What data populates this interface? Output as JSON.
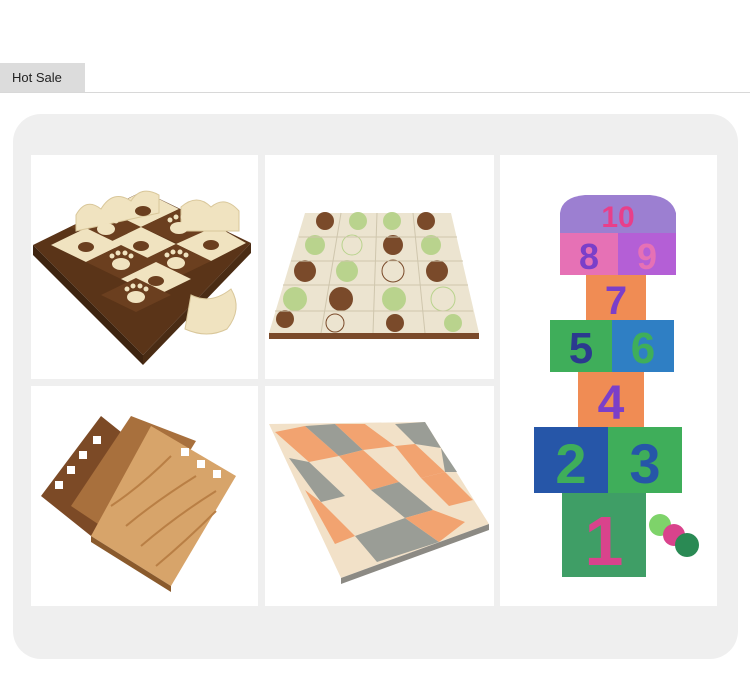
{
  "section": {
    "tab_label": "Hot Sale"
  },
  "products": [
    {
      "name": "paw-print-foam-mat-with-fence",
      "colors": [
        "#6b3f1f",
        "#f0e3c0"
      ]
    },
    {
      "name": "green-brown-circle-foam-mat",
      "colors": [
        "#7a4a2a",
        "#b9d38d",
        "#ece4d0"
      ]
    },
    {
      "name": "hopscotch-number-foam-mat",
      "numbers": [
        "10",
        "8",
        "9",
        "7",
        "5",
        "6",
        "4",
        "2",
        "3",
        "1"
      ]
    },
    {
      "name": "wood-grain-foam-tiles",
      "colors": [
        "#a8703d",
        "#d7a46a"
      ]
    },
    {
      "name": "chevron-pattern-foam-mat",
      "colors": [
        "#f2a370",
        "#9a9d96",
        "#f2e1c8"
      ]
    }
  ]
}
